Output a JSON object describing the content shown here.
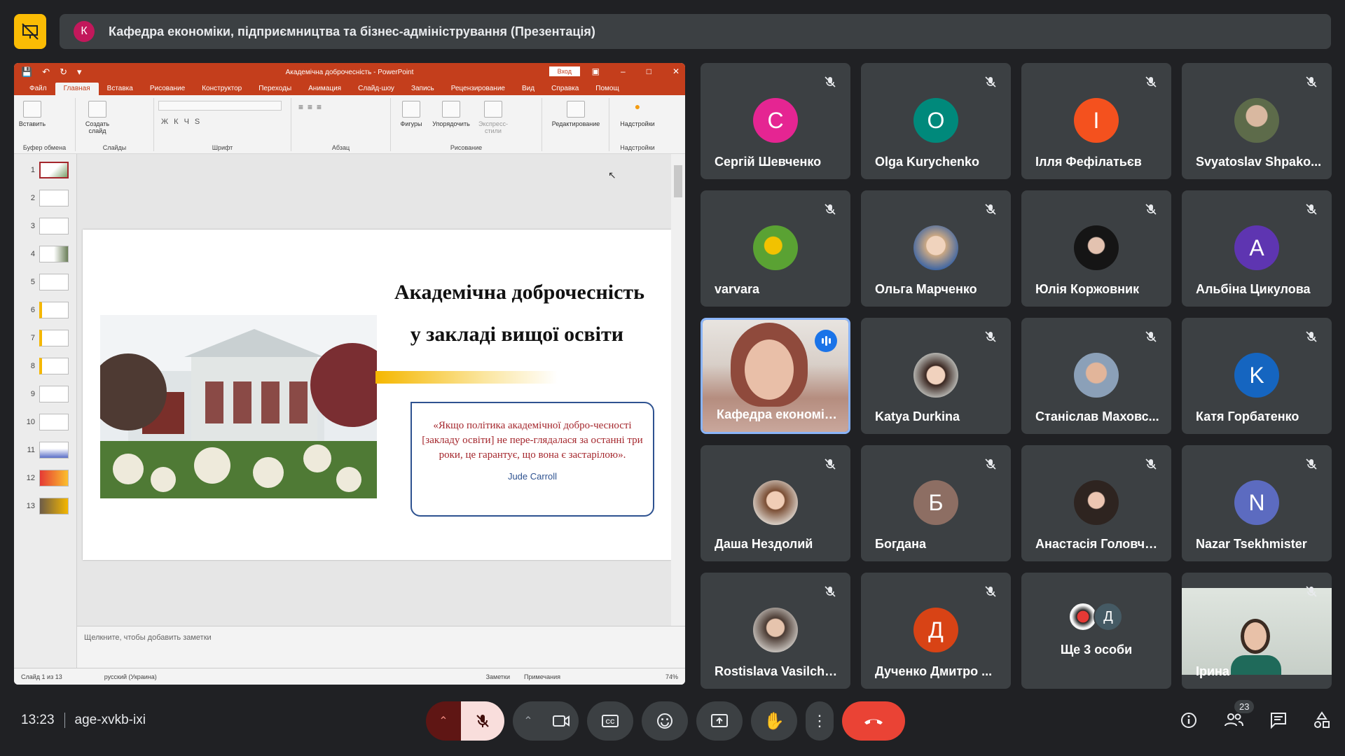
{
  "meeting": {
    "title": "Кафедра економіки, підприємництва та бізнес-адміністрування (Презентація)",
    "presenter_initial": "К",
    "time": "13:23",
    "code": "age-xvkb-ixi",
    "participants_count": "23"
  },
  "ppt": {
    "doc_title": "Академічна доброчесність  -  PowerPoint",
    "signin": "Вход",
    "tabs": [
      "Файл",
      "Главная",
      "Вставка",
      "Рисование",
      "Конструктор",
      "Переходы",
      "Анимация",
      "Слайд-шоу",
      "Запись",
      "Рецензирование",
      "Вид",
      "Справка",
      "Помощ"
    ],
    "ribbon": {
      "paste": "Вставить",
      "new_slide": "Создать слайд",
      "clipboard": "Буфер обмена",
      "slides": "Слайды",
      "font": "Шрифт",
      "paragraph": "Абзац",
      "shapes": "Фигуры",
      "arrange": "Упорядочить",
      "express_styles": "Экспресс-стили",
      "drawing": "Рисование",
      "editing": "Редактирование",
      "addins": "Надстройки",
      "addins_group": "Надстройки"
    },
    "slide_numbers": [
      "1",
      "2",
      "3",
      "4",
      "5",
      "6",
      "7",
      "8",
      "9",
      "10",
      "11",
      "12",
      "13"
    ],
    "slide": {
      "title_line1": "Академічна доброчесність",
      "title_line2": "у закладі вищої освіти",
      "quote": "«Якщо політика академічної добро-чесності [закладу освіти] не пере-глядалася за останні три роки, це гарантує, що вона є застарілою».",
      "author": "Jude Carroll"
    },
    "notes_placeholder": "Щелкните, чтобы добавить заметки",
    "status": {
      "slide_info": "Слайд 1 из 13",
      "language": "русский (Украина)",
      "notes": "Заметки",
      "comments": "Примечания",
      "zoom": "74%"
    }
  },
  "participants": [
    {
      "name": "Сергій Шевченко",
      "initial": "С",
      "color": "#e52592",
      "type": "initial"
    },
    {
      "name": "Olga Kurychenko",
      "initial": "O",
      "color": "#00897b",
      "type": "initial"
    },
    {
      "name": "Ілля Фефілатьєв",
      "initial": "I",
      "color": "#f4511e",
      "type": "initial"
    },
    {
      "name": "Svyatoslav Shpako...",
      "initial": "",
      "color": "#6d7a5a",
      "type": "photo"
    },
    {
      "name": "varvara",
      "initial": "",
      "color": "#8bb43a",
      "type": "photo"
    },
    {
      "name": "Ольга Марченко",
      "initial": "",
      "color": "#c9b39a",
      "type": "photo"
    },
    {
      "name": "Юлія Коржовник",
      "initial": "",
      "color": "#2b2b2b",
      "type": "photo"
    },
    {
      "name": "Альбіна Цикулова",
      "initial": "A",
      "color": "#5e35b1",
      "type": "initial"
    },
    {
      "name": "Кафедра економік...",
      "initial": "",
      "color": "#9a7b70",
      "type": "video"
    },
    {
      "name": "Katya Durkina",
      "initial": "",
      "color": "#d4bba5",
      "type": "photo"
    },
    {
      "name": "Станіслав Маховс...",
      "initial": "",
      "color": "#b7a79a",
      "type": "photo"
    },
    {
      "name": "Катя Горбатенко",
      "initial": "K",
      "color": "#1565c0",
      "type": "initial"
    },
    {
      "name": "Даша Нездолий",
      "initial": "",
      "color": "#a07e6a",
      "type": "photo"
    },
    {
      "name": "Богдана",
      "initial": "Б",
      "color": "#8d6e63",
      "type": "initial"
    },
    {
      "name": "Анастасія Головче...",
      "initial": "",
      "color": "#3a2f2b",
      "type": "photo"
    },
    {
      "name": "Nazar Tsekhmister",
      "initial": "N",
      "color": "#5c6bc0",
      "type": "initial"
    },
    {
      "name": "Rostislava Vasilche...",
      "initial": "",
      "color": "#7d6a5d",
      "type": "photo"
    },
    {
      "name": "Дученко Дмитро ...",
      "initial": "Д",
      "color": "#d84315",
      "type": "initial"
    },
    {
      "name": "Ще 3 особи",
      "initial": "Д",
      "color": "#455a64",
      "type": "more"
    },
    {
      "name": "Ірина",
      "initial": "",
      "color": "#cfd6cf",
      "type": "video"
    }
  ],
  "colors": {
    "accent": "#8ab4f8",
    "end_call": "#ea4335",
    "mic_off_bg": "#f9dedc",
    "ppt_brand": "#c43e1c"
  }
}
